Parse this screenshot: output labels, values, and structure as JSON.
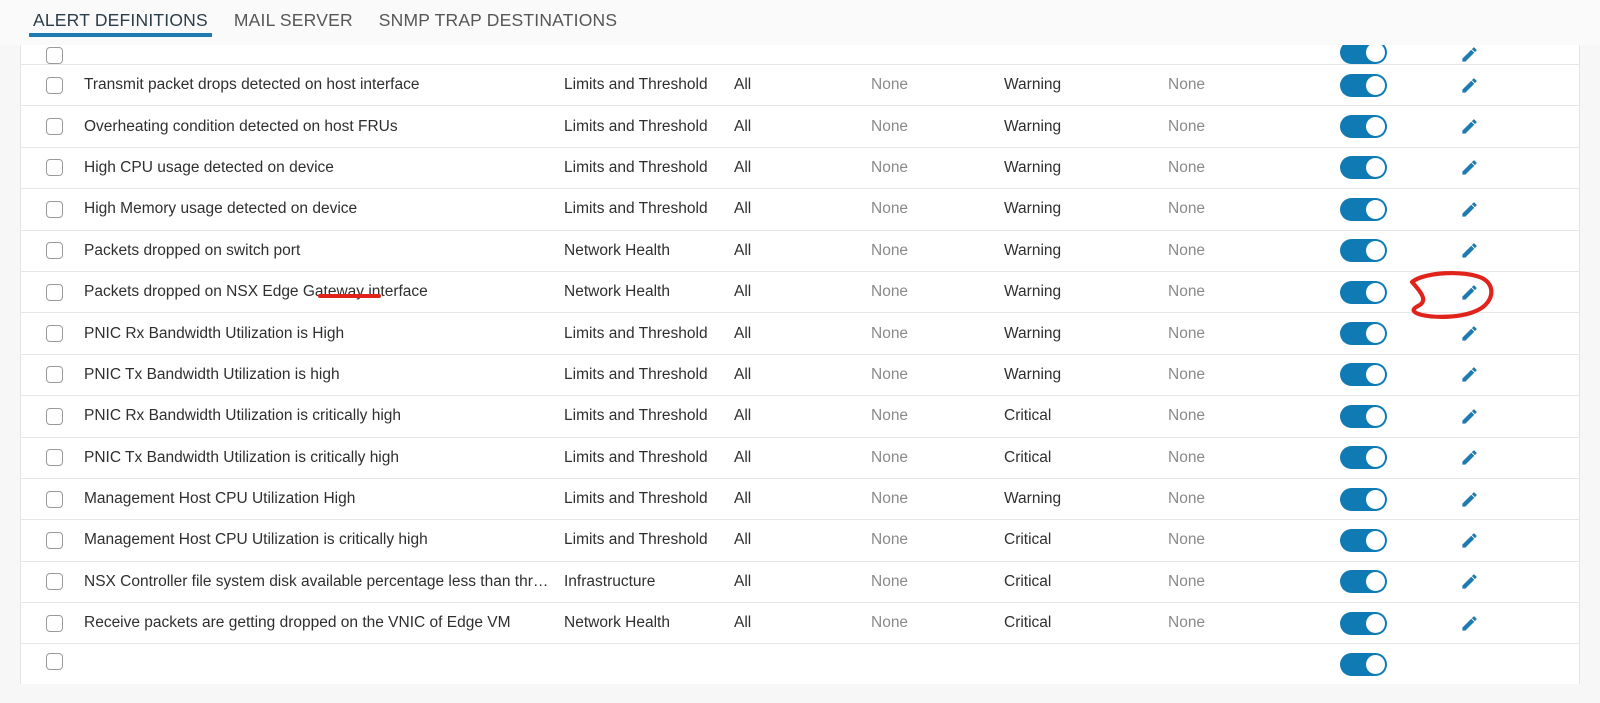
{
  "tabs": [
    {
      "label": "ALERT DEFINITIONS",
      "active": true
    },
    {
      "label": "MAIL SERVER",
      "active": false
    },
    {
      "label": "SNMP TRAP DESTINATIONS",
      "active": false
    }
  ],
  "colors": {
    "accent": "#1e7bb1",
    "toggle_on": "#0f7ab4",
    "pencil": "#1e7bb1",
    "annotation_red": "#e0241c",
    "muted_text": "#8a8a8a",
    "body_text": "#2f2f2f"
  },
  "icons": {
    "checkbox": "checkbox-unchecked-icon",
    "toggle": "toggle-switch-on-icon",
    "edit": "pencil-edit-icon"
  },
  "annotations": [
    {
      "type": "underline",
      "target_row": 4,
      "color": "#e0241c"
    },
    {
      "type": "circle",
      "target": "edit-pencil-row-4",
      "color": "#e0241c"
    }
  ],
  "table": {
    "rows": [
      {
        "name": "Transmit packet drops detected on host interface",
        "category": "Limits and Threshold",
        "scope": "All",
        "info": "None",
        "severity": "Warning",
        "critical": "None",
        "enabled": true
      },
      {
        "name": "Overheating condition detected on host FRUs",
        "category": "Limits and Threshold",
        "scope": "All",
        "info": "None",
        "severity": "Warning",
        "critical": "None",
        "enabled": true
      },
      {
        "name": "High CPU usage detected on device",
        "category": "Limits and Threshold",
        "scope": "All",
        "info": "None",
        "severity": "Warning",
        "critical": "None",
        "enabled": true
      },
      {
        "name": "High Memory usage detected on device",
        "category": "Limits and Threshold",
        "scope": "All",
        "info": "None",
        "severity": "Warning",
        "critical": "None",
        "enabled": true
      },
      {
        "name": "Packets dropped on switch port",
        "category": "Network Health",
        "scope": "All",
        "info": "None",
        "severity": "Warning",
        "critical": "None",
        "enabled": true
      },
      {
        "name": "Packets dropped on NSX Edge Gateway interface",
        "category": "Network Health",
        "scope": "All",
        "info": "None",
        "severity": "Warning",
        "critical": "None",
        "enabled": true
      },
      {
        "name": "PNIC Rx Bandwidth Utilization is High",
        "category": "Limits and Threshold",
        "scope": "All",
        "info": "None",
        "severity": "Warning",
        "critical": "None",
        "enabled": true
      },
      {
        "name": "PNIC Tx Bandwidth Utilization is high",
        "category": "Limits and Threshold",
        "scope": "All",
        "info": "None",
        "severity": "Warning",
        "critical": "None",
        "enabled": true
      },
      {
        "name": "PNIC Rx Bandwidth Utilization is critically high",
        "category": "Limits and Threshold",
        "scope": "All",
        "info": "None",
        "severity": "Critical",
        "critical": "None",
        "enabled": true
      },
      {
        "name": "PNIC Tx Bandwidth Utilization is critically high",
        "category": "Limits and Threshold",
        "scope": "All",
        "info": "None",
        "severity": "Critical",
        "critical": "None",
        "enabled": true
      },
      {
        "name": "Management Host CPU Utilization High",
        "category": "Limits and Threshold",
        "scope": "All",
        "info": "None",
        "severity": "Warning",
        "critical": "None",
        "enabled": true
      },
      {
        "name": "Management Host CPU Utilization is critically high",
        "category": "Limits and Threshold",
        "scope": "All",
        "info": "None",
        "severity": "Critical",
        "critical": "None",
        "enabled": true
      },
      {
        "name": "NSX Controller file system disk available percentage less than thr…",
        "category": "Infrastructure",
        "scope": "All",
        "info": "None",
        "severity": "Critical",
        "critical": "None",
        "enabled": true
      },
      {
        "name": "Receive packets are getting dropped on the VNIC of Edge VM",
        "category": "Network Health",
        "scope": "All",
        "info": "None",
        "severity": "Critical",
        "critical": "None",
        "enabled": true
      }
    ]
  }
}
